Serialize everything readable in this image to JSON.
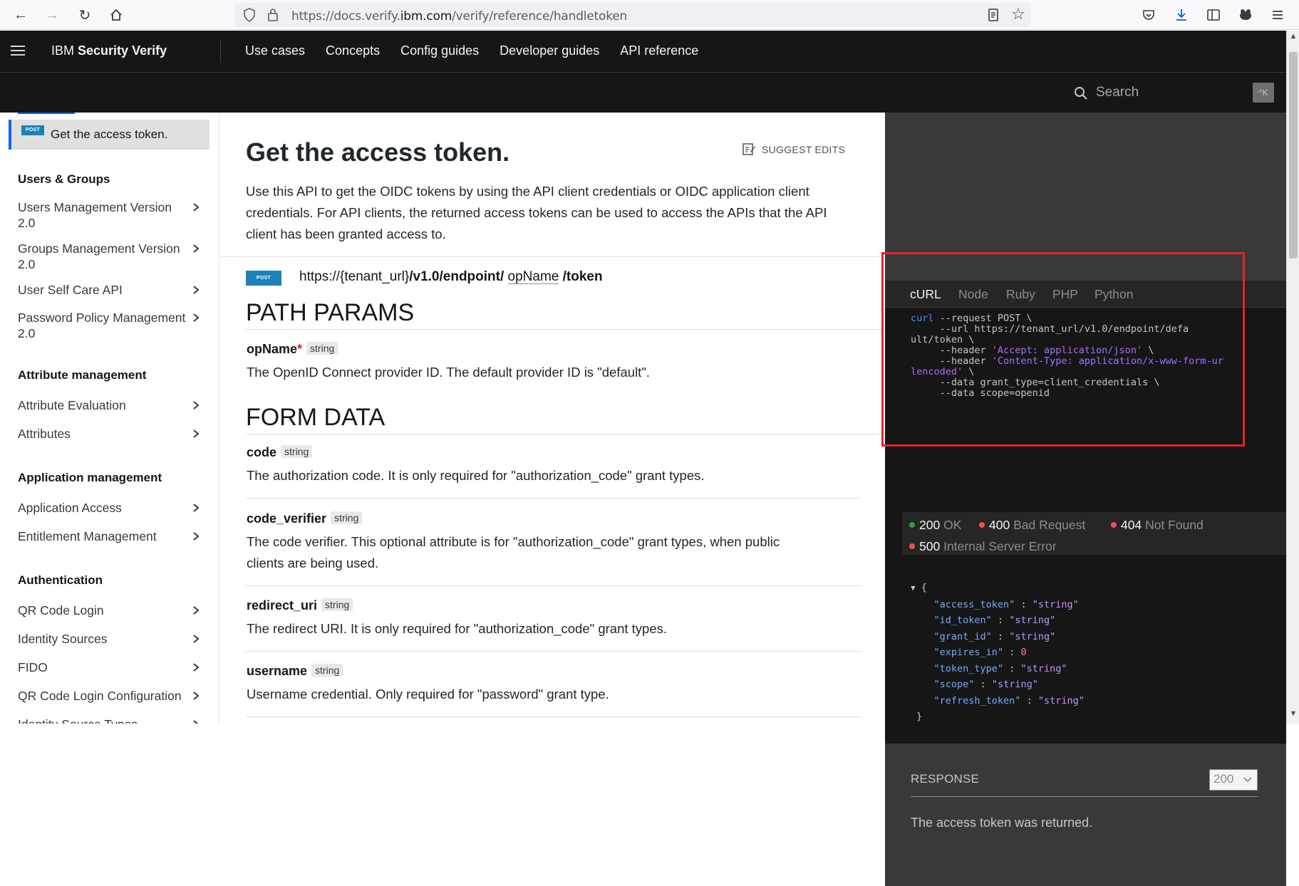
{
  "browser": {
    "url_prefix": "https://docs.verify.",
    "url_domain": "ibm.com",
    "url_path": "/verify/reference/handletoken"
  },
  "header": {
    "brand_prefix": "IBM",
    "brand_name": "Security Verify",
    "nav": [
      "Use cases",
      "Concepts",
      "Config guides",
      "Developer guides",
      "API reference"
    ],
    "search_placeholder": "Search",
    "search_shortcut": "^K"
  },
  "sidebar": {
    "active_badge": "POST",
    "active_label": "Get the access token.",
    "sections": [
      {
        "title": "Users & Groups",
        "items": [
          "Users Management Version 2.0",
          "Groups Management Version 2.0",
          "User Self Care API",
          "Password Policy Management 2.0"
        ]
      },
      {
        "title": "Attribute management",
        "items": [
          "Attribute Evaluation",
          "Attributes"
        ]
      },
      {
        "title": "Application management",
        "items": [
          "Application Access",
          "Entitlement Management"
        ]
      },
      {
        "title": "Authentication",
        "items": [
          "QR Code Login",
          "Identity Sources",
          "FIDO",
          "QR Code Login Configuration",
          "Identity Source Types"
        ]
      }
    ]
  },
  "main": {
    "title": "Get the access token.",
    "suggest_edits": "SUGGEST EDITS",
    "description": "Use this API to get the OIDC tokens by using the API client credentials or OIDC application client credentials. For API clients, the returned access tokens can be used to access the APIs that the API client has been granted access to.",
    "method": "POST",
    "endpoint": {
      "base": "https://{tenant_url}",
      "path1": "/v1.0/endpoint/",
      "param": "opName",
      "path2": "/token"
    },
    "path_params_title": "PATH PARAMS",
    "path_params": [
      {
        "name": "opName",
        "required": "*",
        "type": "string",
        "desc": "The OpenID Connect provider ID. The default provider ID is \"default\"."
      }
    ],
    "form_data_title": "FORM DATA",
    "form_data": [
      {
        "name": "code",
        "type": "string",
        "desc": "The authorization code. It is only required for \"authorization_code\" grant types."
      },
      {
        "name": "code_verifier",
        "type": "string",
        "desc": "The code verifier. This optional attribute is for \"authorization_code\" grant types, when public clients are being used."
      },
      {
        "name": "redirect_uri",
        "type": "string",
        "desc": "The redirect URI. It is only required for \"authorization_code\" grant types."
      },
      {
        "name": "username",
        "type": "string",
        "desc": "Username credential. Only required for \"password\" grant type."
      }
    ]
  },
  "code_panel": {
    "tabs": [
      "cURL",
      "Node",
      "Ruby",
      "PHP",
      "Python"
    ],
    "active_tab": "cURL",
    "curl": {
      "cmd": "curl",
      "line1": " --request POST \\",
      "line2": "     --url https://tenant_url/v1.0/endpoint/defa",
      "line3": "ult/token \\",
      "header_flag": "     --header ",
      "accept": "'Accept: application/json'",
      "cont": " \\",
      "ctype": "'Content-Type: application/x-www-form-ur",
      "ctype2": "lencoded'",
      "data1": "     --data grant_type=client_credentials \\",
      "data2": "     --data scope=openid"
    },
    "statuses": [
      {
        "code": "200",
        "text": "OK",
        "color": "#24a148"
      },
      {
        "code": "400",
        "text": "Bad Request",
        "color": "#fa4d56"
      },
      {
        "code": "404",
        "text": "Not Found",
        "color": "#fa4d56"
      },
      {
        "code": "500",
        "text": "Internal Server Error",
        "color": "#fa4d56"
      }
    ],
    "json_response": {
      "access_token": "\"string\"",
      "id_token": "\"string\"",
      "grant_id": "\"string\"",
      "expires_in": "0",
      "token_type": "\"string\"",
      "scope": "\"string\"",
      "refresh_token": "\"string\""
    },
    "response_label": "RESPONSE",
    "response_code": "200",
    "response_desc": "The access token was returned."
  },
  "colors": {
    "highlight": "#e3232b",
    "accent": "#0f62fe",
    "post_badge": "#1c82b8"
  }
}
